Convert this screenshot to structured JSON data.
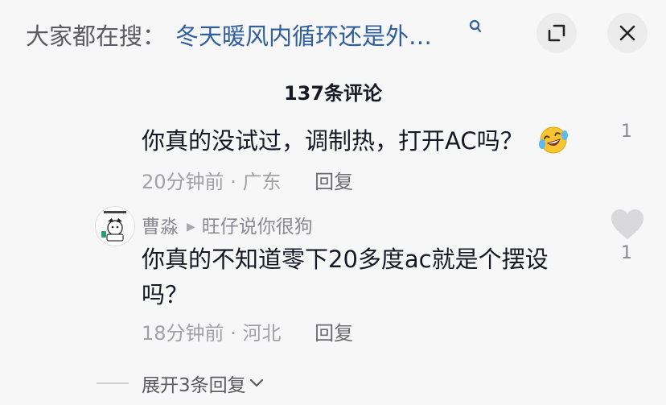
{
  "top_bar": {
    "search_prefix": "大家都在搜：",
    "search_query": "冬天暖风内循环还是外…",
    "search_icon": "search-icon",
    "expand_icon": "expand-icon",
    "close_icon": "close-icon"
  },
  "comment_count": "137条评论",
  "replies": [
    {
      "text": "你真的没试过，调制热，打开AC吗？",
      "emoji": "laughing-crying-emoji",
      "time": "20分钟前",
      "location": "· 广东",
      "reply_label": "回复",
      "likes": "1"
    },
    {
      "author": "曹淼",
      "reply_to": "旺仔说你很狗",
      "text": "你真的不知道零下20多度ac就是个摆设吗？",
      "time": "18分钟前",
      "location": "· 河北",
      "reply_label": "回复",
      "likes": "1",
      "heart_icon": "heart-icon"
    }
  ],
  "expand_replies": "展开3条回复",
  "colors": {
    "background": "#f7f7f7",
    "search_query": "#2f5f9e",
    "primary_text": "#161823",
    "secondary_text": "#a0a0a6"
  }
}
